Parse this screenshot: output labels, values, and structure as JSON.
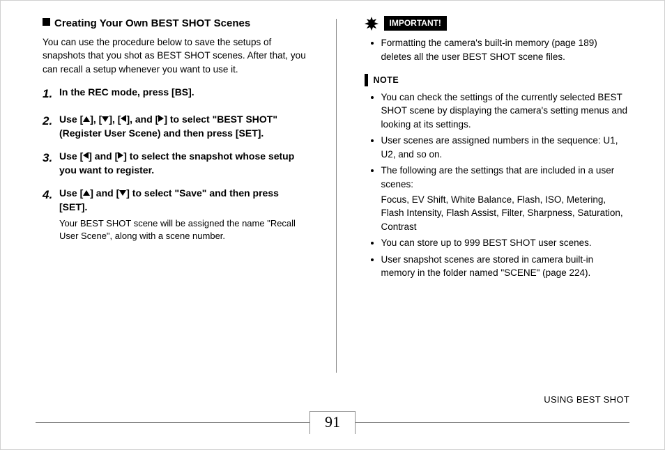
{
  "left": {
    "heading": "Creating Your Own BEST SHOT Scenes",
    "intro": "You can use the procedure below to save the setups of snapshots that you shot as BEST SHOT scenes. After that, you can recall a setup whenever you want to use it.",
    "steps": {
      "s1": {
        "num": "1.",
        "title": "In the REC mode, press [BS]."
      },
      "s2": {
        "num": "2.",
        "pre": "Use [",
        "mid1": "], [",
        "mid2": "], [",
        "mid3": "], and [",
        "post": "] to select \"BEST SHOT\" (Register User Scene) and then press [SET]."
      },
      "s3": {
        "num": "3.",
        "pre": "Use [",
        "mid": "] and [",
        "post": "] to select the snapshot whose setup you want to register."
      },
      "s4": {
        "num": "4.",
        "pre": "Use [",
        "mid": "] and [",
        "post": "] to select \"Save\" and then press [SET].",
        "sub": "Your BEST SHOT scene will be assigned the name \"Recall User Scene\", along with a scene number."
      }
    }
  },
  "right": {
    "important_label": "IMPORTANT!",
    "important_item": "Formatting the camera's built-in memory (page 189) deletes all the user BEST SHOT scene files.",
    "note_label": "NOTE",
    "notes": {
      "n1": "You can check the settings of the currently selected BEST SHOT scene by displaying the camera's setting menus and looking at its settings.",
      "n2": "User scenes are assigned numbers in the sequence: U1, U2, and so on.",
      "n3": "The following are the settings that are included in a user scenes:",
      "n3sub": "Focus, EV Shift, White Balance, Flash, ISO, Metering, Flash Intensity, Flash Assist, Filter, Sharpness, Saturation, Contrast",
      "n4": "You can store up to 999 BEST SHOT user scenes.",
      "n5": "User snapshot scenes are stored in camera built-in memory in the folder named \"SCENE\" (page 224)."
    }
  },
  "footer": {
    "page": "91",
    "chapter": "USING BEST SHOT"
  }
}
